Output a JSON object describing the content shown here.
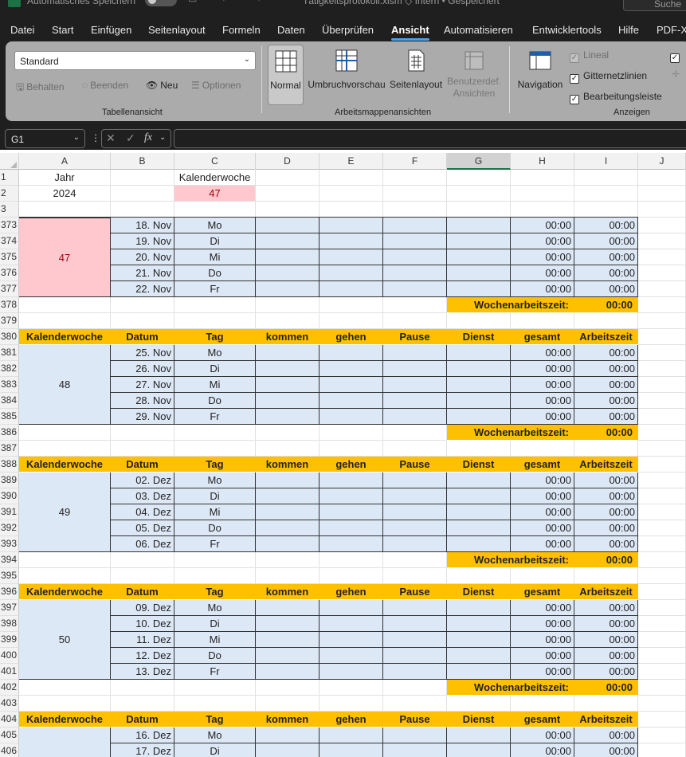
{
  "titlebar": {
    "autosave_label": "Automatisches Speichern",
    "file_name": "Tätigkeitsprotokoll.xlsm",
    "status": "Intern • Gespeichert",
    "search_placeholder": "Suche"
  },
  "tabs": [
    "Datei",
    "Start",
    "Einfügen",
    "Seitenlayout",
    "Formeln",
    "Daten",
    "Überprüfen",
    "Ansicht",
    "Automatisieren",
    "Entwicklertools",
    "Hilfe",
    "PDF-X"
  ],
  "active_tab": "Ansicht",
  "ribbon": {
    "sheetview": {
      "select_value": "Standard",
      "keep": "Behalten",
      "exit": "Beenden",
      "new": "Neu",
      "options": "Optionen",
      "group_label": "Tabellenansicht"
    },
    "workbook_views": {
      "normal": "Normal",
      "page_break": "Umbruchvorschau",
      "page_layout": "Seitenlayout",
      "custom_1": "Benutzerdef.",
      "custom_2": "Ansichten",
      "group_label": "Arbeitsmappenansichten"
    },
    "show": {
      "navigation": "Navigation",
      "ruler": "Lineal",
      "gridlines": "Gitternetzlinien",
      "formula_bar": "Bearbeitungsleiste",
      "group_label": "Anzeigen"
    }
  },
  "formula_bar": {
    "name_box": "G1",
    "fx": "fx",
    "value": ""
  },
  "columns": [
    "A",
    "B",
    "C",
    "D",
    "E",
    "F",
    "G",
    "H",
    "I",
    "J"
  ],
  "top": {
    "row_numbers": [
      "1",
      "2",
      "3"
    ],
    "year_label": "Jahr",
    "year_value": "2024",
    "week_label": "Kalenderwoche",
    "week_value": "47"
  },
  "header_labels": [
    "Kalenderwoche",
    "Datum",
    "Tag",
    "kommen",
    "gehen",
    "Pause",
    "Dienst",
    "gesamt",
    "Arbeitszeit"
  ],
  "weekly_label": "Wochenarbeitszeit:",
  "weeks": [
    {
      "week": "47",
      "header_row": "",
      "sum_row": "378",
      "gap_row": "379",
      "sum": "00:00",
      "days": [
        {
          "row": "373",
          "date": "18. Nov",
          "day": "Mo",
          "gesamt": "00:00",
          "arbeitszeit": "00:00"
        },
        {
          "row": "374",
          "date": "19. Nov",
          "day": "Di",
          "gesamt": "00:00",
          "arbeitszeit": "00:00"
        },
        {
          "row": "375",
          "date": "20. Nov",
          "day": "Mi",
          "gesamt": "00:00",
          "arbeitszeit": "00:00"
        },
        {
          "row": "376",
          "date": "21. Nov",
          "day": "Do",
          "gesamt": "00:00",
          "arbeitszeit": "00:00"
        },
        {
          "row": "377",
          "date": "22. Nov",
          "day": "Fr",
          "gesamt": "00:00",
          "arbeitszeit": "00:00"
        }
      ]
    },
    {
      "week": "48",
      "header_row": "380",
      "sum_row": "386",
      "gap_row": "387",
      "sum": "00:00",
      "days": [
        {
          "row": "381",
          "date": "25. Nov",
          "day": "Mo",
          "gesamt": "00:00",
          "arbeitszeit": "00:00"
        },
        {
          "row": "382",
          "date": "26. Nov",
          "day": "Di",
          "gesamt": "00:00",
          "arbeitszeit": "00:00"
        },
        {
          "row": "383",
          "date": "27. Nov",
          "day": "Mi",
          "gesamt": "00:00",
          "arbeitszeit": "00:00"
        },
        {
          "row": "384",
          "date": "28. Nov",
          "day": "Do",
          "gesamt": "00:00",
          "arbeitszeit": "00:00"
        },
        {
          "row": "385",
          "date": "29. Nov",
          "day": "Fr",
          "gesamt": "00:00",
          "arbeitszeit": "00:00"
        }
      ]
    },
    {
      "week": "49",
      "header_row": "388",
      "sum_row": "394",
      "gap_row": "395",
      "sum": "00:00",
      "days": [
        {
          "row": "389",
          "date": "02. Dez",
          "day": "Mo",
          "gesamt": "00:00",
          "arbeitszeit": "00:00"
        },
        {
          "row": "390",
          "date": "03. Dez",
          "day": "Di",
          "gesamt": "00:00",
          "arbeitszeit": "00:00"
        },
        {
          "row": "391",
          "date": "04. Dez",
          "day": "Mi",
          "gesamt": "00:00",
          "arbeitszeit": "00:00"
        },
        {
          "row": "392",
          "date": "05. Dez",
          "day": "Do",
          "gesamt": "00:00",
          "arbeitszeit": "00:00"
        },
        {
          "row": "393",
          "date": "06. Dez",
          "day": "Fr",
          "gesamt": "00:00",
          "arbeitszeit": "00:00"
        }
      ]
    },
    {
      "week": "50",
      "header_row": "396",
      "sum_row": "402",
      "gap_row": "403",
      "sum": "00:00",
      "days": [
        {
          "row": "397",
          "date": "09. Dez",
          "day": "Mo",
          "gesamt": "00:00",
          "arbeitszeit": "00:00"
        },
        {
          "row": "398",
          "date": "10. Dez",
          "day": "Di",
          "gesamt": "00:00",
          "arbeitszeit": "00:00"
        },
        {
          "row": "399",
          "date": "11. Dez",
          "day": "Mi",
          "gesamt": "00:00",
          "arbeitszeit": "00:00"
        },
        {
          "row": "400",
          "date": "12. Dez",
          "day": "Do",
          "gesamt": "00:00",
          "arbeitszeit": "00:00"
        },
        {
          "row": "401",
          "date": "13. Dez",
          "day": "Fr",
          "gesamt": "00:00",
          "arbeitszeit": "00:00"
        }
      ]
    },
    {
      "week": "",
      "header_row": "404",
      "sum_row": "",
      "gap_row": "",
      "sum": "",
      "days": [
        {
          "row": "405",
          "date": "16. Dez",
          "day": "Mo",
          "gesamt": "00:00",
          "arbeitszeit": "00:00"
        },
        {
          "row": "406",
          "date": "17. Dez",
          "day": "Di",
          "gesamt": "00:00",
          "arbeitszeit": "00:00"
        }
      ]
    }
  ],
  "colors": {
    "header_orange": "#ffc000",
    "day_blue": "#dde8f6",
    "highlight_pink": "#ffc7ce",
    "highlight_text": "#9c0006",
    "accent_blue": "#4ca1e8"
  }
}
